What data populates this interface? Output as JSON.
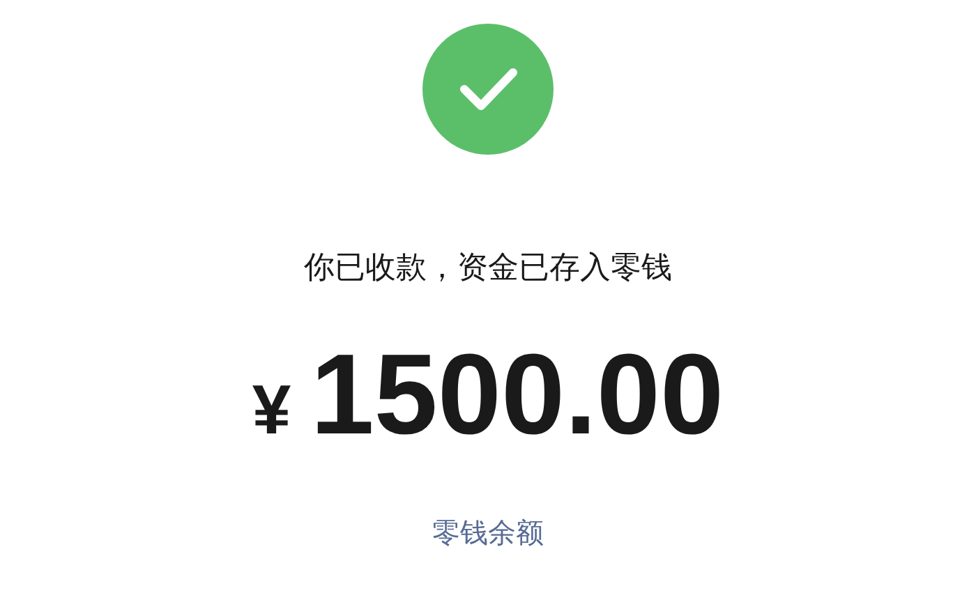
{
  "status_icon": {
    "kind": "success"
  },
  "message": "你已收款，资金已存入零钱",
  "amount": {
    "currency": "¥",
    "value": "1500.00"
  },
  "balance_link": "零钱余额"
}
